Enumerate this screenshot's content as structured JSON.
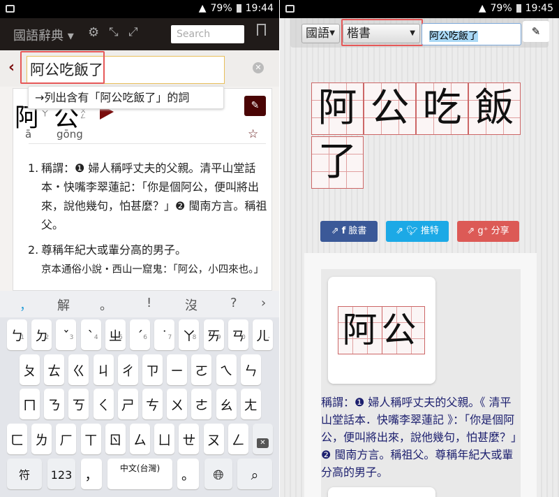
{
  "left": {
    "status": {
      "battery": "79%",
      "time": "19:44"
    },
    "appbar": {
      "title": "國語辭典",
      "search_placeholder": "Search"
    },
    "search": {
      "value": "阿公吃飯了",
      "suggestion": "→列出含有「阿公吃飯了」的詞"
    },
    "entry": {
      "chars": [
        {
          "char": "阿",
          "zhuyin": "ㄚ",
          "pinyin": "ā"
        },
        {
          "char": "公",
          "zhuyin": "ㄍㄨㄥ",
          "pinyin": "gōng"
        }
      ],
      "definitions": [
        {
          "num": "1.",
          "text": "稱謂：❶ 婦人稱呼丈夫的父親。清平山堂話本・快嘴李翠蓮記：「你是個阿公，便叫將出來，說他幾句，怕甚麼？」❷ 閩南方言。稱祖父。"
        },
        {
          "num": "2.",
          "text": "尊稱年紀大或輩分高的男子。",
          "example": "京本通俗小說・西山一窟鬼：「阿公，小四來也。」"
        }
      ]
    },
    "keyboard": {
      "suggestions": [
        "，",
        "解",
        "。",
        "!",
        "沒",
        "?",
        "›"
      ],
      "row1": [
        [
          "ㄅ",
          "1"
        ],
        [
          "ㄉ",
          "2"
        ],
        [
          "ˇ",
          "3"
        ],
        [
          "ˋ",
          "4"
        ],
        [
          "ㄓ",
          "5"
        ],
        [
          "ˊ",
          "6"
        ],
        [
          "˙",
          "7"
        ],
        [
          "ㄚ",
          "8"
        ],
        [
          "ㄞ",
          "9"
        ],
        [
          "ㄢ",
          "0"
        ],
        [
          "ㄦ",
          "-"
        ]
      ],
      "row2": [
        "ㄆ",
        "ㄊ",
        "ㄍ",
        "ㄐ",
        "ㄔ",
        "ㄗ",
        "ㄧ",
        "ㄛ",
        "ㄟ",
        "ㄣ"
      ],
      "row3": [
        "ㄇ",
        "ㄋ",
        "ㄎ",
        "ㄑ",
        "ㄕ",
        "ㄘ",
        "ㄨ",
        "ㄜ",
        "ㄠ",
        "ㄤ"
      ],
      "row4": [
        "ㄈ",
        "ㄌ",
        "ㄏ",
        "ㄒ",
        "ㄖ",
        "ㄙ",
        "ㄩ",
        "ㄝ",
        "ㄡ",
        "ㄥ"
      ],
      "symbols": "符",
      "numbers": "123",
      "comma": "，",
      "space": "中文(台灣)",
      "period": "。"
    }
  },
  "right": {
    "status": {
      "battery": "79%",
      "time": "19:45"
    },
    "toolbar": {
      "language": "國語",
      "font": "楷書",
      "input": "阿公吃飯了"
    },
    "chars": [
      "阿",
      "公",
      "吃",
      "飯",
      "了"
    ],
    "share": {
      "facebook": "臉書",
      "twitter": "推特",
      "google": "分享"
    },
    "word": "阿公",
    "definition": "稱謂：❶ 婦人稱呼丈夫的父親。《 清平山堂話本．快嘴李翠蓮記 》：「你是個阿公，便叫將出來，說他幾句，怕甚麼？」❷ 閩南方言。稱祖父。尊稱年紀大或輩分高的男子。"
  },
  "colors": {
    "brand": "#4a0505",
    "facebook": "#3b5998",
    "twitter": "#1ca9e6",
    "google": "#dc5a56",
    "definition": "#1c1f6e"
  }
}
